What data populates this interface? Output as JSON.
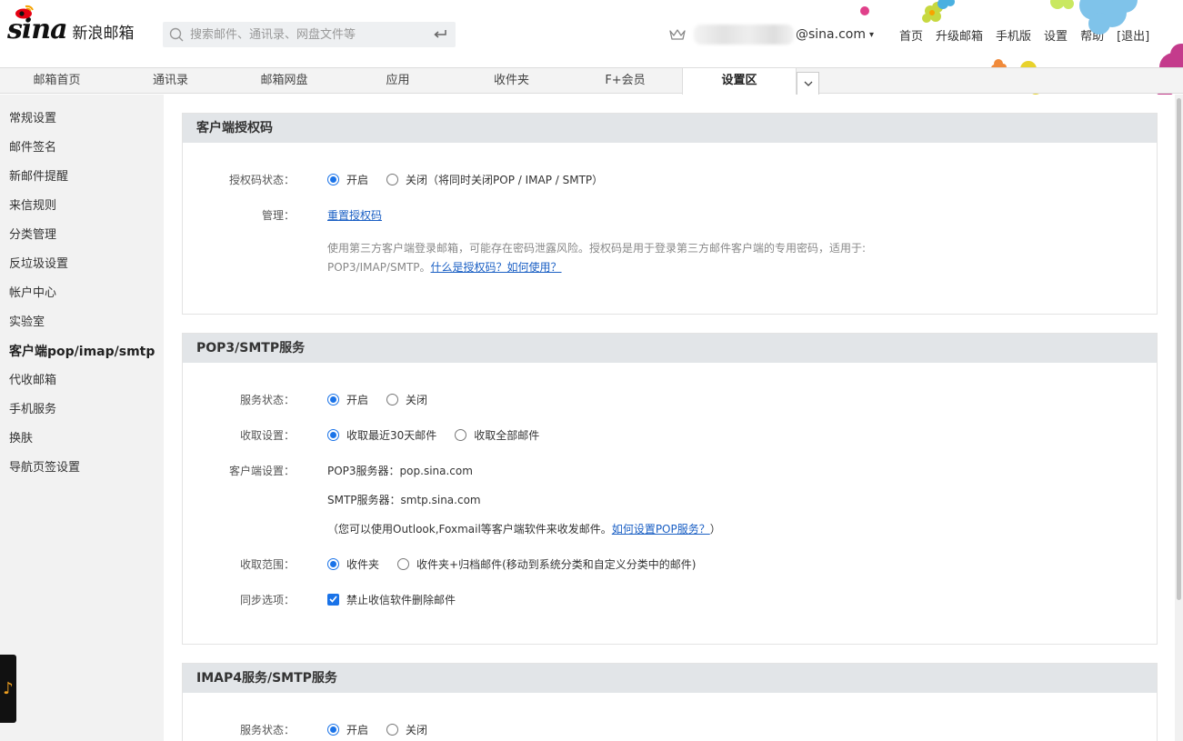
{
  "header": {
    "logo_text": "sina",
    "product_name": "新浪邮箱",
    "search_placeholder": "搜索邮件、通讯录、网盘文件等",
    "user_email": "@sina.com",
    "links": [
      "首页",
      "升级邮箱",
      "手机版",
      "设置",
      "帮助",
      "[退出]"
    ]
  },
  "nav": {
    "tabs": [
      "邮箱首页",
      "通讯录",
      "邮箱网盘",
      "应用",
      "收件夹",
      "F+会员",
      "设置区"
    ],
    "active": "设置区"
  },
  "sidebar": {
    "items": [
      "常规设置",
      "邮件签名",
      "新邮件提醒",
      "来信规则",
      "分类管理",
      "反垃圾设置",
      "帐户中心",
      "实验室",
      "客户端pop/imap/smtp",
      "代收邮箱",
      "手机服务",
      "换肤",
      "导航页签设置"
    ],
    "active": "客户端pop/imap/smtp"
  },
  "auth": {
    "title": "客户端授权码",
    "status_label": "授权码状态：",
    "on": "开启",
    "off": "关闭（将同时关闭POP / IMAP / SMTP）",
    "manage_label": "管理：",
    "reset_link": "重置授权码",
    "note1": "使用第三方客户端登录邮箱，可能存在密码泄露风险。授权码是用于登录第三方邮件客户端的专用密码，适用于:",
    "note2": "POP3/IMAP/SMTP。",
    "note_link": "什么是授权码？如何使用？"
  },
  "pop": {
    "title": "POP3/SMTP服务",
    "service_label": "服务状态：",
    "on": "开启",
    "off": "关闭",
    "fetch_label": "收取设置：",
    "fetch_recent": "收取最近30天邮件",
    "fetch_all": "收取全部邮件",
    "client_label": "客户端设置：",
    "pop3_server": "POP3服务器：pop.sina.com",
    "smtp_server": "SMTP服务器：smtp.sina.com",
    "client_note": "（您可以使用Outlook,Foxmail等客户端软件来收发邮件。",
    "client_link": "如何设置POP服务？",
    "client_note_end": "）",
    "range_label": "收取范围：",
    "range_inbox": "收件夹",
    "range_archive": "收件夹+归档邮件(移动到系统分类和自定义分类中的邮件)",
    "sync_label": "同步选项：",
    "sync_option": "禁止收信软件删除邮件"
  },
  "imap": {
    "title": "IMAP4服务/SMTP服务",
    "service_label": "服务状态：",
    "on": "开启",
    "off": "关闭"
  },
  "colors": {
    "accent": "#1a73e8",
    "link": "#1a5fc4",
    "section_head": "#e2e5e8",
    "sidebar": "#f2f2f2"
  }
}
